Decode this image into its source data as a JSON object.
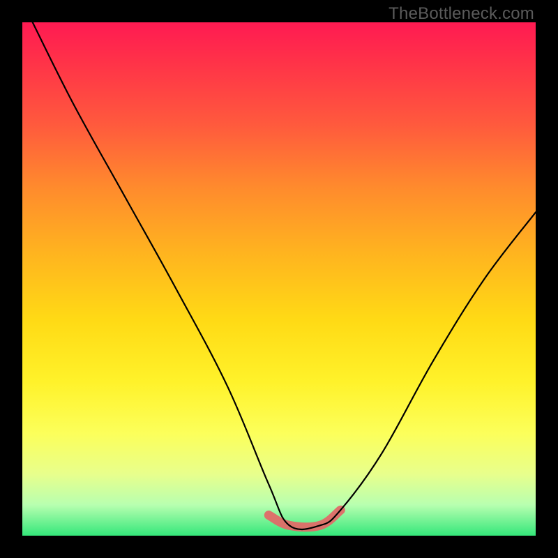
{
  "watermark": "TheBottleneck.com",
  "colors": {
    "gradient_top": "#ff1a52",
    "gradient_mid": "#ffe533",
    "gradient_bottom": "#34e77a",
    "curve": "#000000",
    "valley": "#e06a68",
    "background": "#000000"
  },
  "chart_data": {
    "type": "line",
    "title": "",
    "xlabel": "",
    "ylabel": "",
    "xlim": [
      0,
      100
    ],
    "ylim": [
      0,
      100
    ],
    "series": [
      {
        "name": "curve",
        "x": [
          2,
          10,
          20,
          30,
          40,
          48,
          52,
          58,
          62,
          70,
          80,
          90,
          100
        ],
        "y": [
          100,
          84,
          66,
          48,
          29,
          10,
          2,
          2,
          5,
          16,
          34,
          50,
          63
        ]
      },
      {
        "name": "valley_highlight",
        "x": [
          48,
          52,
          58,
          62
        ],
        "y": [
          4,
          2,
          2,
          5
        ]
      }
    ],
    "annotations": []
  }
}
